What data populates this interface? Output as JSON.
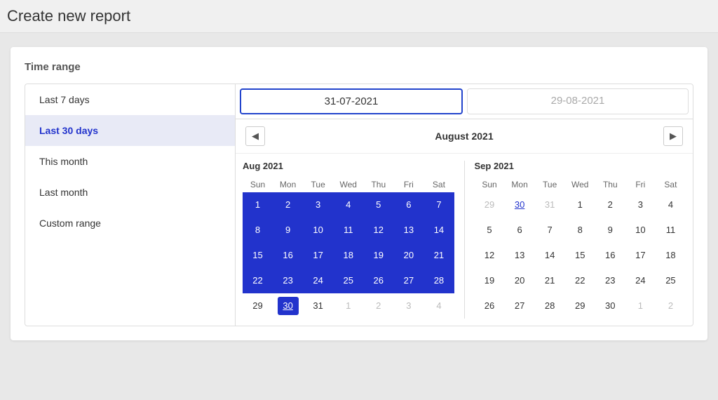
{
  "header": {
    "title": "Create new report"
  },
  "section": {
    "label": "Time range"
  },
  "range_options": [
    {
      "id": "last7",
      "label": "Last 7 days",
      "active": false
    },
    {
      "id": "last30",
      "label": "Last 30 days",
      "active": true
    },
    {
      "id": "thismonth",
      "label": "This month",
      "active": false
    },
    {
      "id": "lastmonth",
      "label": "Last month",
      "active": false
    },
    {
      "id": "custom",
      "label": "Custom range",
      "active": false
    }
  ],
  "date_fields": {
    "start": "31-07-2021",
    "end": "29-08-2021"
  },
  "calendar_nav": {
    "title": "August 2021",
    "prev_label": "◀",
    "next_label": "▶"
  },
  "calendars": {
    "left": {
      "month_label": "Aug 2021",
      "weekdays": [
        "Sun",
        "Mon",
        "Tue",
        "Wed",
        "Thu",
        "Fri",
        "Sat"
      ],
      "weeks": [
        [
          {
            "day": 1,
            "type": "range"
          },
          {
            "day": 2,
            "type": "range"
          },
          {
            "day": 3,
            "type": "range"
          },
          {
            "day": 4,
            "type": "range"
          },
          {
            "day": 5,
            "type": "range"
          },
          {
            "day": 6,
            "type": "range"
          },
          {
            "day": 7,
            "type": "range"
          }
        ],
        [
          {
            "day": 8,
            "type": "range"
          },
          {
            "day": 9,
            "type": "range"
          },
          {
            "day": 10,
            "type": "range"
          },
          {
            "day": 11,
            "type": "range"
          },
          {
            "day": 12,
            "type": "range"
          },
          {
            "day": 13,
            "type": "range"
          },
          {
            "day": 14,
            "type": "range"
          }
        ],
        [
          {
            "day": 15,
            "type": "range"
          },
          {
            "day": 16,
            "type": "range"
          },
          {
            "day": 17,
            "type": "range"
          },
          {
            "day": 18,
            "type": "range"
          },
          {
            "day": 19,
            "type": "range"
          },
          {
            "day": 20,
            "type": "range"
          },
          {
            "day": 21,
            "type": "range"
          }
        ],
        [
          {
            "day": 22,
            "type": "range"
          },
          {
            "day": 23,
            "type": "range"
          },
          {
            "day": 24,
            "type": "range"
          },
          {
            "day": 25,
            "type": "range"
          },
          {
            "day": 26,
            "type": "range"
          },
          {
            "day": 27,
            "type": "range"
          },
          {
            "day": 28,
            "type": "range"
          }
        ],
        [
          {
            "day": 29,
            "type": "range"
          },
          {
            "day": 30,
            "type": "today",
            "underline": true
          },
          {
            "day": 31,
            "type": "normal"
          },
          {
            "day": 1,
            "type": "other"
          },
          {
            "day": 2,
            "type": "other"
          },
          {
            "day": 3,
            "type": "other"
          },
          {
            "day": 4,
            "type": "other"
          }
        ]
      ]
    },
    "right": {
      "month_label": "Sep 2021",
      "weekdays": [
        "Sun",
        "Mon",
        "Tue",
        "Wed",
        "Thu",
        "Fri",
        "Sat"
      ],
      "weeks": [
        [
          {
            "day": 29,
            "type": "other"
          },
          {
            "day": 30,
            "type": "today-other",
            "underline": true
          },
          {
            "day": 31,
            "type": "other"
          },
          {
            "day": 1,
            "type": "normal"
          },
          {
            "day": 2,
            "type": "normal"
          },
          {
            "day": 3,
            "type": "normal"
          },
          {
            "day": 4,
            "type": "normal"
          }
        ],
        [
          {
            "day": 5,
            "type": "normal"
          },
          {
            "day": 6,
            "type": "normal"
          },
          {
            "day": 7,
            "type": "normal"
          },
          {
            "day": 8,
            "type": "normal"
          },
          {
            "day": 9,
            "type": "normal"
          },
          {
            "day": 10,
            "type": "normal"
          },
          {
            "day": 11,
            "type": "normal"
          }
        ],
        [
          {
            "day": 12,
            "type": "normal"
          },
          {
            "day": 13,
            "type": "normal"
          },
          {
            "day": 14,
            "type": "normal"
          },
          {
            "day": 15,
            "type": "normal"
          },
          {
            "day": 16,
            "type": "normal"
          },
          {
            "day": 17,
            "type": "normal"
          },
          {
            "day": 18,
            "type": "normal"
          }
        ],
        [
          {
            "day": 19,
            "type": "normal"
          },
          {
            "day": 20,
            "type": "normal"
          },
          {
            "day": 21,
            "type": "normal"
          },
          {
            "day": 22,
            "type": "normal"
          },
          {
            "day": 23,
            "type": "normal"
          },
          {
            "day": 24,
            "type": "normal"
          },
          {
            "day": 25,
            "type": "normal"
          }
        ],
        [
          {
            "day": 26,
            "type": "normal"
          },
          {
            "day": 27,
            "type": "normal"
          },
          {
            "day": 28,
            "type": "normal"
          },
          {
            "day": 29,
            "type": "normal"
          },
          {
            "day": 30,
            "type": "normal"
          },
          {
            "day": 1,
            "type": "other"
          },
          {
            "day": 2,
            "type": "other"
          }
        ]
      ]
    }
  }
}
